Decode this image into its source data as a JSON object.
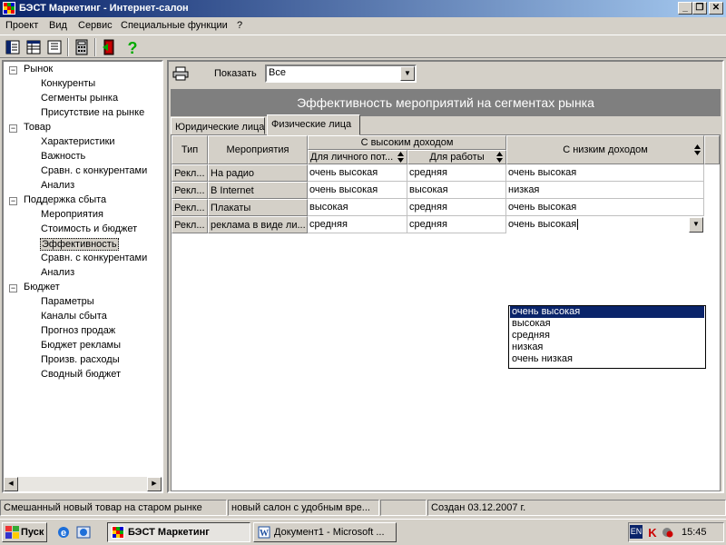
{
  "window": {
    "title": "БЭСТ Маркетинг - Интернет-салон"
  },
  "menu": [
    "Проект",
    "Вид",
    "Сервис",
    "Специальные функции",
    "?"
  ],
  "tree": [
    {
      "label": "Рынок",
      "children": [
        "Конкуренты",
        "Сегменты рынка",
        "Присутствие на рынке"
      ]
    },
    {
      "label": "Товар",
      "children": [
        "Характеристики",
        "Важность",
        "Сравн. с конкурентами",
        "Анализ"
      ]
    },
    {
      "label": "Поддержка сбыта",
      "children": [
        "Мероприятия",
        "Стоимость и бюджет",
        "Эффективность",
        "Сравн. с конкурентами",
        "Анализ"
      ]
    },
    {
      "label": "Бюджет",
      "children": [
        "Параметры",
        "Каналы сбыта",
        "Прогноз продаж",
        "Бюджет рекламы",
        "Произв. расходы",
        "Сводный бюджет"
      ]
    }
  ],
  "main": {
    "show_label": "Показать",
    "show_value": "Все",
    "title": "Эффективность мероприятий на сегментах рынка",
    "tabs": [
      "Юридические лица",
      "Физические лица"
    ],
    "grid": {
      "headers": {
        "type": "Тип",
        "activity": "Мероприятия",
        "high_income": "С высоким доходом",
        "personal": "Для личного пот...",
        "work": "Для работы",
        "low_income": "С низким доходом"
      },
      "rows": [
        {
          "type": "Рекл...",
          "activity": "На радио",
          "personal": "очень высокая",
          "work": "средняя",
          "low": "очень высокая"
        },
        {
          "type": "Рекл...",
          "activity": "В Internet",
          "personal": "очень высокая",
          "work": "высокая",
          "low": "низкая"
        },
        {
          "type": "Рекл...",
          "activity": "Плакаты",
          "personal": "высокая",
          "work": "средняя",
          "low": "очень высокая"
        },
        {
          "type": "Рекл...",
          "activity": "реклама в виде ли...",
          "personal": "средняя",
          "work": "средняя",
          "low": "очень высокая"
        }
      ],
      "dropdown_options": [
        "очень высокая",
        "высокая",
        "средняя",
        "низкая",
        "очень низкая"
      ]
    }
  },
  "status": [
    "Смешанный новый товар на старом рынке",
    "новый салон с удобным вре...",
    "",
    "Создан 03.12.2007 г."
  ],
  "taskbar": {
    "start": "Пуск",
    "tasks": [
      "БЭСТ Маркетинг",
      "Документ1 - Microsoft ..."
    ],
    "lang": "EN",
    "time": "15:45"
  },
  "colors": {
    "title_bar": "#0a246a",
    "banner": "#7f7f7f",
    "selection": "#0a246a",
    "face": "#d4d0c8"
  }
}
